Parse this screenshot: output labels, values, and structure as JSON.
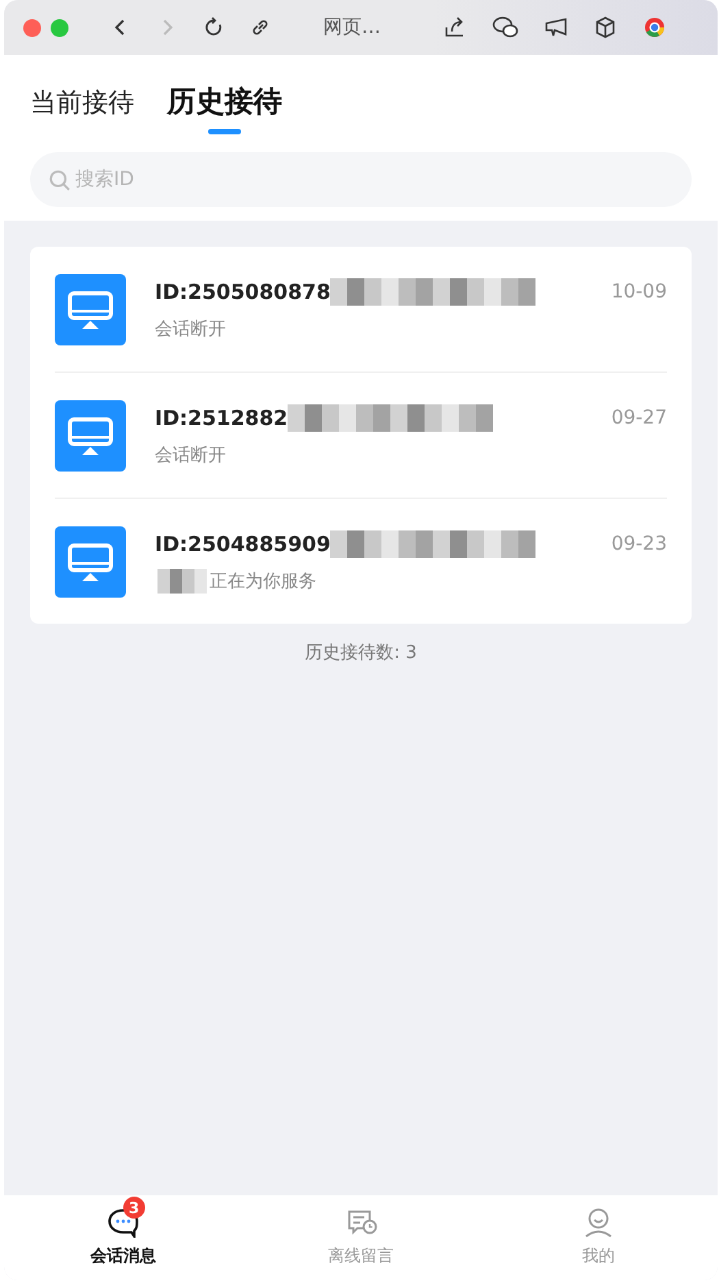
{
  "window": {
    "title": "网页…"
  },
  "tabs": [
    {
      "label": "当前接待",
      "selected": false
    },
    {
      "label": "历史接待",
      "selected": true
    }
  ],
  "search": {
    "placeholder": "搜索ID"
  },
  "sessions": [
    {
      "id": "ID:2505080878",
      "id_redacted": true,
      "status": "会话断开",
      "status_redacted": false,
      "date": "10-09"
    },
    {
      "id": "ID:2512882",
      "id_redacted": true,
      "status": "会话断开",
      "status_redacted": false,
      "date": "09-27"
    },
    {
      "id": "ID:2504885909",
      "id_redacted": true,
      "status": "正在为你服务",
      "status_redacted": true,
      "date": "09-23"
    }
  ],
  "history_count": "历史接待数: 3",
  "nav": [
    {
      "kind": "chat",
      "label": "会话消息",
      "selected": true,
      "badge": "3"
    },
    {
      "kind": "message",
      "label": "离线留言",
      "selected": false
    },
    {
      "kind": "user",
      "label": "我的",
      "selected": false
    }
  ]
}
